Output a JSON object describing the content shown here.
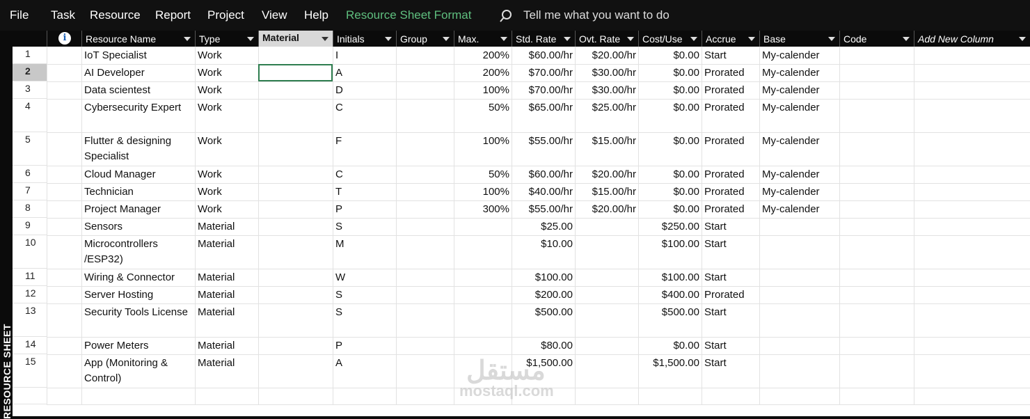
{
  "menu": {
    "items": [
      "File",
      "Task",
      "Resource",
      "Report",
      "Project",
      "View",
      "Help"
    ],
    "accent_tab": "Resource Sheet Format",
    "tell_me_placeholder": "Tell me what you want to do",
    "accent_color": "#5fbf7f"
  },
  "side_label": "RESOURCE SHEET",
  "columns": [
    {
      "label": "",
      "icon": "info-icon"
    },
    {
      "label": "Resource Name"
    },
    {
      "label": "Type"
    },
    {
      "label": "Material",
      "active": true
    },
    {
      "label": "Initials"
    },
    {
      "label": "Group"
    },
    {
      "label": "Max."
    },
    {
      "label": "Std. Rate"
    },
    {
      "label": "Ovt. Rate"
    },
    {
      "label": "Cost/Use"
    },
    {
      "label": "Accrue"
    },
    {
      "label": "Base"
    },
    {
      "label": "Code"
    },
    {
      "label": "Add New Column",
      "italic": true
    }
  ],
  "rows": [
    {
      "id": "1",
      "name": "IoT Specialist",
      "type": "Work",
      "material": "",
      "initials": "I",
      "group": "",
      "max": "200%",
      "std": "$60.00/hr",
      "ovt": "$20.00/hr",
      "cost": "$0.00",
      "accrue": "Start",
      "base": "My-calender"
    },
    {
      "id": "2",
      "name": "AI Developer",
      "type": "Work",
      "material": "",
      "initials": "A",
      "group": "",
      "max": "200%",
      "std": "$70.00/hr",
      "ovt": "$30.00/hr",
      "cost": "$0.00",
      "accrue": "Prorated",
      "base": "My-calender"
    },
    {
      "id": "3",
      "name": "Data scientest",
      "type": "Work",
      "material": "",
      "initials": "D",
      "group": "",
      "max": "100%",
      "std": "$70.00/hr",
      "ovt": "$30.00/hr",
      "cost": "$0.00",
      "accrue": "Prorated",
      "base": "My-calender"
    },
    {
      "id": "4",
      "name": "Cybersecurity Expert",
      "type": "Work",
      "material": "",
      "initials": "C",
      "group": "",
      "max": "50%",
      "std": "$65.00/hr",
      "ovt": "$25.00/hr",
      "cost": "$0.00",
      "accrue": "Prorated",
      "base": "My-calender"
    },
    {
      "id": "5",
      "name": "Flutter & designing Specialist",
      "type": "Work",
      "material": "",
      "initials": "F",
      "group": "",
      "max": "100%",
      "std": "$55.00/hr",
      "ovt": "$15.00/hr",
      "cost": "$0.00",
      "accrue": "Prorated",
      "base": "My-calender"
    },
    {
      "id": "6",
      "name": "Cloud Manager",
      "type": "Work",
      "material": "",
      "initials": "C",
      "group": "",
      "max": "50%",
      "std": "$60.00/hr",
      "ovt": "$20.00/hr",
      "cost": "$0.00",
      "accrue": "Prorated",
      "base": "My-calender"
    },
    {
      "id": "7",
      "name": "Technician",
      "type": "Work",
      "material": "",
      "initials": "T",
      "group": "",
      "max": "100%",
      "std": "$40.00/hr",
      "ovt": "$15.00/hr",
      "cost": "$0.00",
      "accrue": "Prorated",
      "base": "My-calender"
    },
    {
      "id": "8",
      "name": "Project Manager",
      "type": "Work",
      "material": "",
      "initials": "P",
      "group": "",
      "max": "300%",
      "std": "$55.00/hr",
      "ovt": "$20.00/hr",
      "cost": "$0.00",
      "accrue": "Prorated",
      "base": "My-calender"
    },
    {
      "id": "9",
      "name": "Sensors",
      "type": "Material",
      "material": "",
      "initials": "S",
      "group": "",
      "max": "",
      "std": "$25.00",
      "ovt": "",
      "cost": "$250.00",
      "accrue": "Start",
      "base": ""
    },
    {
      "id": "10",
      "name": "Microcontrollers /ESP32)",
      "type": "Material",
      "material": "",
      "initials": "M",
      "group": "",
      "max": "",
      "std": "$10.00",
      "ovt": "",
      "cost": "$100.00",
      "accrue": "Start",
      "base": ""
    },
    {
      "id": "11",
      "name": "Wiring & Connector",
      "type": "Material",
      "material": "",
      "initials": "W",
      "group": "",
      "max": "",
      "std": "$100.00",
      "ovt": "",
      "cost": "$100.00",
      "accrue": "Start",
      "base": ""
    },
    {
      "id": "12",
      "name": "Server Hosting",
      "type": "Material",
      "material": "",
      "initials": "S",
      "group": "",
      "max": "",
      "std": "$200.00",
      "ovt": "",
      "cost": "$400.00",
      "accrue": "Prorated",
      "base": ""
    },
    {
      "id": "13",
      "name": "Security Tools License",
      "type": "Material",
      "material": "",
      "initials": "S",
      "group": "",
      "max": "",
      "std": "$500.00",
      "ovt": "",
      "cost": "$500.00",
      "accrue": "Start",
      "base": ""
    },
    {
      "id": "14",
      "name": "Power Meters",
      "type": "Material",
      "material": "",
      "initials": "P",
      "group": "",
      "max": "",
      "std": "$80.00",
      "ovt": "",
      "cost": "$0.00",
      "accrue": "Start",
      "base": ""
    },
    {
      "id": "15",
      "name": "App (Monitoring & Control)",
      "type": "Material",
      "material": "",
      "initials": "A",
      "group": "",
      "max": "",
      "std": "$1,500.00",
      "ovt": "",
      "cost": "$1,500.00",
      "accrue": "Start",
      "base": ""
    },
    {
      "id": "",
      "name": "",
      "type": "",
      "material": "",
      "initials": "",
      "group": "",
      "max": "",
      "std": "",
      "ovt": "",
      "cost": "",
      "accrue": "",
      "base": ""
    }
  ],
  "selected_row": "2",
  "watermark": {
    "arabic": "مستقل",
    "latin": "mostaql.com"
  }
}
